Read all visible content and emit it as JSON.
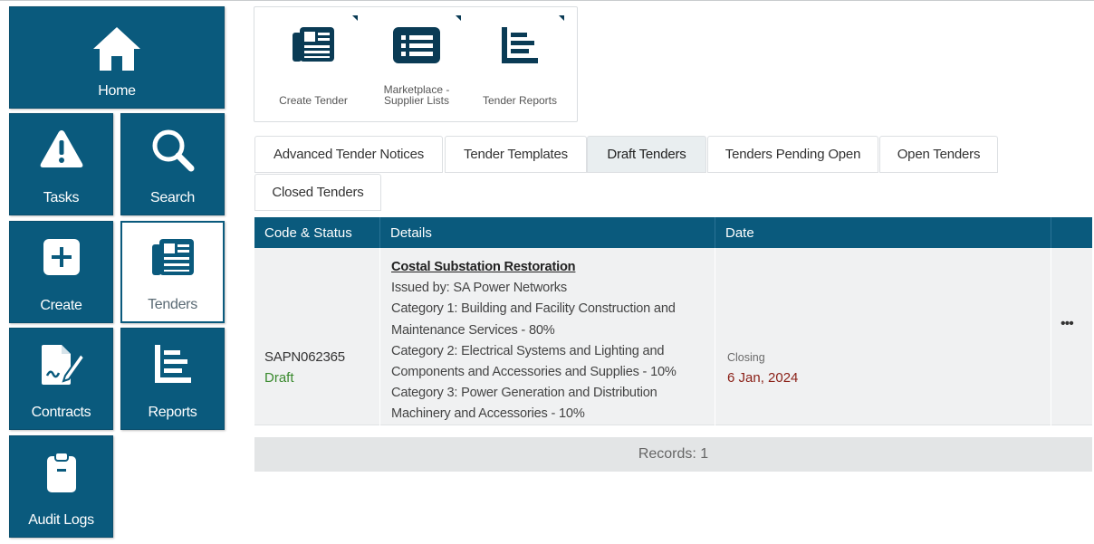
{
  "nav": {
    "home": "Home",
    "tasks": "Tasks",
    "search": "Search",
    "create": "Create",
    "tenders": "Tenders",
    "contracts": "Contracts",
    "reports": "Reports",
    "audit_logs": "Audit Logs"
  },
  "quick_actions": {
    "create_tender": "Create Tender",
    "marketplace_line1": "Marketplace -",
    "marketplace_line2": "Supplier Lists",
    "tender_reports": "Tender Reports"
  },
  "tabs": [
    {
      "label": "Advanced Tender Notices",
      "active": false
    },
    {
      "label": "Tender Templates",
      "active": false
    },
    {
      "label": "Draft Tenders",
      "active": true
    },
    {
      "label": "Tenders Pending Open",
      "active": false
    },
    {
      "label": "Open Tenders",
      "active": false
    },
    {
      "label": "Closed Tenders",
      "active": false
    }
  ],
  "table": {
    "columns": [
      "Code & Status",
      "Details",
      "Date",
      ""
    ],
    "rows": [
      {
        "code": "SAPN062365",
        "status": "Draft",
        "title": "Costal Substation Restoration",
        "details": [
          "Issued by: SA Power Networks",
          "Category 1: Building and Facility Construction and",
          "Maintenance Services - 80%",
          "Category 2: Electrical Systems and Lighting and",
          "Components and Accessories and Supplies - 10%",
          "Category 3: Power Generation and Distribution",
          "Machinery and Accessories - 10%"
        ],
        "date_caption": "Closing",
        "date_value": "6 Jan, 2024",
        "actions": "•••"
      }
    ]
  },
  "records": "Records: 1",
  "colors": {
    "brand": "#0a5a7d",
    "status_draft": "#3a8a2e",
    "closing_date": "#8a1f16"
  },
  "icons": {
    "home": "home-icon",
    "tasks": "warning-triangle-icon",
    "search": "magnifier-icon",
    "create": "plus-square-icon",
    "tenders": "newspaper-icon",
    "contracts": "signed-document-icon",
    "reports": "bar-list-icon",
    "audit_logs": "clipboard-icon"
  }
}
